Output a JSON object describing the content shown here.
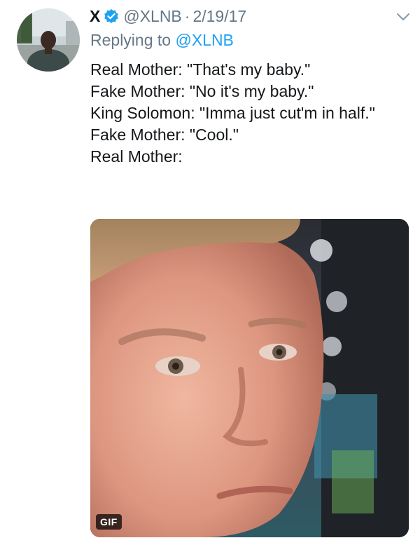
{
  "tweet": {
    "display_name": "X",
    "handle": "@XLNB",
    "separator": "·",
    "date": "2/19/17",
    "reply_prefix": "Replying to",
    "reply_handle": "@XLNB",
    "lines": [
      "Real Mother: \"That's my baby.\"",
      "Fake Mother: \"No it's my baby.\"",
      "King Solomon: \"Imma just cut'm in half.\"",
      "Fake Mother: \"Cool.\"",
      "Real Mother:"
    ]
  },
  "media": {
    "badge": "GIF",
    "subject": "man with blinking reaction face"
  },
  "icons": {
    "verified": "verified-badge-icon",
    "caret": "chevron-down-icon"
  },
  "colors": {
    "verified": "#1da1f2",
    "link": "#1da1f2",
    "muted": "#657786",
    "text": "#14171a"
  }
}
